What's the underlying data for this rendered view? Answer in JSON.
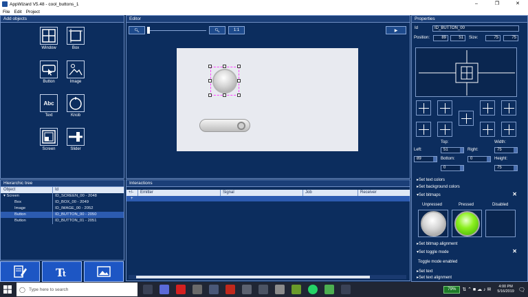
{
  "window": {
    "title": "AppWizard V5.48 - cool_buttons_1",
    "controls": [
      "–",
      "❐",
      "✕"
    ]
  },
  "menu": [
    "File",
    "Edit",
    "Project"
  ],
  "add_objects": {
    "title": "Add objects",
    "tools": [
      {
        "label": "Window",
        "icon": "window-icon"
      },
      {
        "label": "Box",
        "icon": "box-icon"
      },
      {
        "label": "Button",
        "icon": "button-icon"
      },
      {
        "label": "Image",
        "icon": "image-icon"
      },
      {
        "label": "Text",
        "icon": "text-icon",
        "glyph": "Abc"
      },
      {
        "label": "Knob",
        "icon": "knob-icon"
      },
      {
        "label": "Screen",
        "icon": "screen-icon"
      },
      {
        "label": "Slider",
        "icon": "slider-icon"
      }
    ]
  },
  "tree": {
    "title": "Hierarchic tree",
    "columns": [
      "Object",
      "Id"
    ],
    "rows": [
      {
        "object": "▾ Screen",
        "id": "ID_SCREEN_00 - 2048",
        "selected": false
      },
      {
        "object": "Box",
        "id": "ID_BOX_00 - 2049",
        "selected": false
      },
      {
        "object": "Image",
        "id": "ID_IMAGE_00 - 2052",
        "selected": false
      },
      {
        "object": "Button",
        "id": "ID_BUTTON_00 - 2050",
        "selected": true
      },
      {
        "object": "Button",
        "id": "ID_BUTTON_01 - 2051",
        "selected": false
      }
    ]
  },
  "editor": {
    "title": "Editor",
    "zoom_ratio": "1:1"
  },
  "interactions": {
    "title": "Interactions",
    "columns": [
      "+/-",
      "Emitter",
      "Signal",
      "Job",
      "Receiver"
    ],
    "add_row": "+"
  },
  "properties": {
    "title": "Properties",
    "id_label": "Id",
    "id_value": "ID_BUTTON_00",
    "position_label": "Position:",
    "pos_x": "89",
    "pos_y": "51",
    "size_label": "Size:",
    "size_w": "75",
    "size_h": "75",
    "top_label": "Top:",
    "width_label": "Width:",
    "left_label": "Left:",
    "right_label": "Right:",
    "bottom_label": "Bottom:",
    "height_label": "Height:",
    "top_value": "51",
    "width_value": "75",
    "left_value": "89",
    "right_value": "0",
    "bottom_value": "0",
    "height_value": "75",
    "sections": [
      {
        "label": "Set text colors",
        "open": false
      },
      {
        "label": "Set background colors",
        "open": false
      },
      {
        "label": "Set bitmaps",
        "open": true
      },
      {
        "label": "Set bitmap alignment",
        "open": false
      },
      {
        "label": "Set toggle mode",
        "open": true
      },
      {
        "label": "Set text",
        "open": false
      },
      {
        "label": "Set text alignment",
        "open": false
      }
    ],
    "bitmap_states": [
      "Unpressed",
      "Pressed",
      "Disabled"
    ],
    "toggle_text": "Toggle mode enabled"
  },
  "taskbar": {
    "search_placeholder": "Type here to search",
    "battery": "79%",
    "time": "4:00 PM",
    "date": "5/16/2019"
  },
  "colors": {
    "panel_bg": "#0c2d5e",
    "accent": "#2c5bb0",
    "selection": "#ff40ff",
    "pressed_green": "#66e000"
  }
}
